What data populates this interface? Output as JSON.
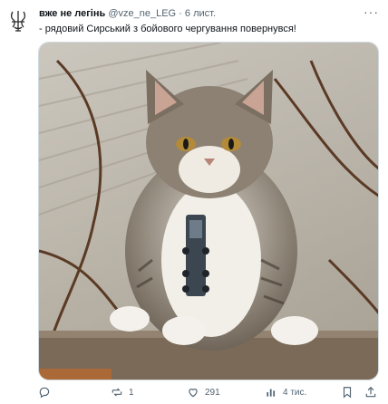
{
  "post": {
    "author_name": "вже не легінь",
    "handle": "@vze_ne_LEG",
    "separator": "·",
    "time": "6 лист.",
    "more_icon": "more-dots-icon",
    "text": "- рядовий Сирський з бойового чергування повернувся!",
    "media": {
      "description_icon": "photo"
    }
  },
  "actions": {
    "reply_count": "",
    "repost_count": "1",
    "like_count": "291",
    "views_count": "4 тис.",
    "icons": [
      "reply-icon",
      "repost-icon",
      "like-icon",
      "views-icon",
      "bookmark-icon",
      "share-icon"
    ]
  },
  "colors": {
    "text": "#0f1419",
    "muted": "#536471",
    "border": "#cfd9de"
  }
}
